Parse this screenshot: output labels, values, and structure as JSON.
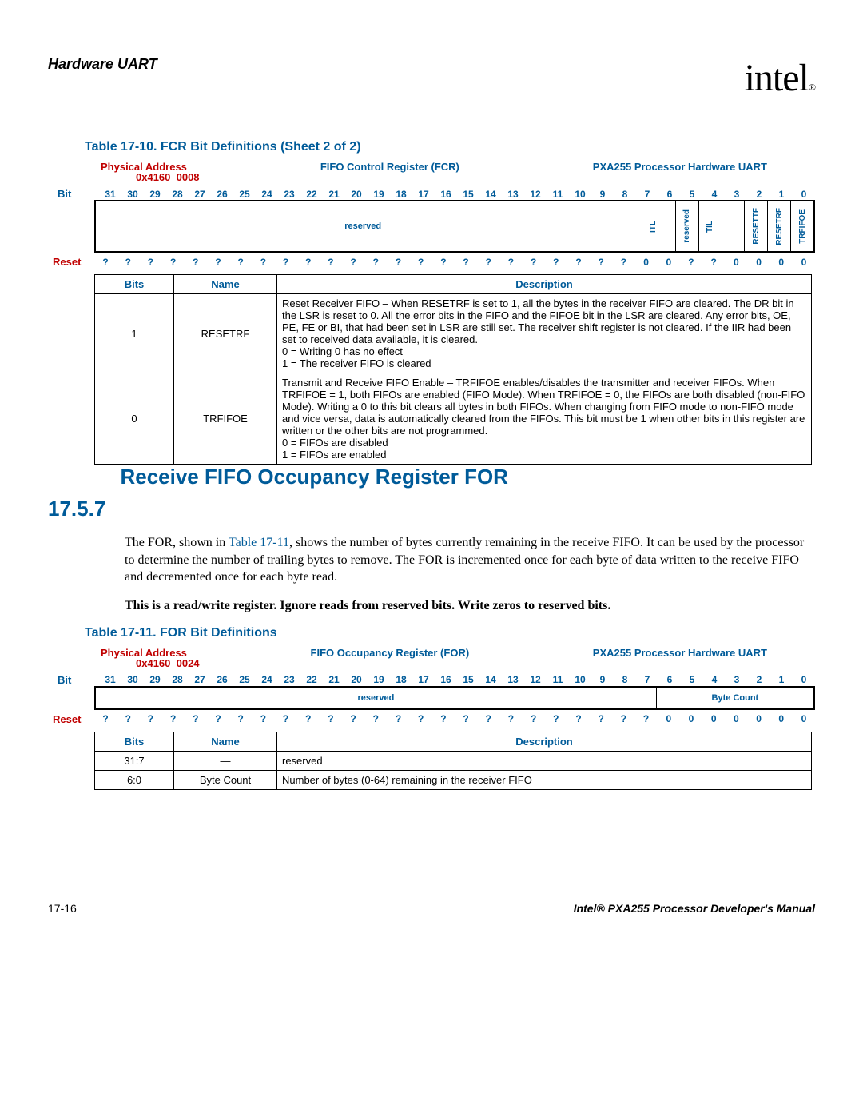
{
  "header": {
    "title": "Hardware UART",
    "logo": "intel",
    "logo_sub": "®"
  },
  "table1": {
    "title": "Table 17-10. FCR Bit Definitions (Sheet 2 of 2)",
    "pa_label": "Physical Address",
    "pa_addr": "0x4160_0008",
    "reg_name": "FIFO Control Register (FCR)",
    "proc": "PXA255 Processor Hardware UART",
    "bit_label": "Bit",
    "reset_label": "Reset",
    "bits": [
      "31",
      "30",
      "29",
      "28",
      "27",
      "26",
      "25",
      "24",
      "23",
      "22",
      "21",
      "20",
      "19",
      "18",
      "17",
      "16",
      "15",
      "14",
      "13",
      "12",
      "11",
      "10",
      "9",
      "8",
      "7",
      "6",
      "5",
      "4",
      "3",
      "2",
      "1",
      "0"
    ],
    "fields": [
      {
        "label": "reserved",
        "span": 24,
        "vert": false
      },
      {
        "label": "ITL",
        "span": 2,
        "vert": true
      },
      {
        "label": "reserved",
        "span": 1,
        "vert": true
      },
      {
        "label": "TIL",
        "span": 1,
        "vert": true
      },
      {
        "label": "",
        "span": 1,
        "vert": false
      },
      {
        "label": "RESETTF",
        "span": 1,
        "vert": true
      },
      {
        "label": "RESETRF",
        "span": 1,
        "vert": true
      },
      {
        "label": "TRFIFOE",
        "span": 1,
        "vert": true
      }
    ],
    "reset": [
      "?",
      "?",
      "?",
      "?",
      "?",
      "?",
      "?",
      "?",
      "?",
      "?",
      "?",
      "?",
      "?",
      "?",
      "?",
      "?",
      "?",
      "?",
      "?",
      "?",
      "?",
      "?",
      "?",
      "?",
      "0",
      "0",
      "?",
      "?",
      "0",
      "0",
      "0",
      "0"
    ],
    "hdr_bits": "Bits",
    "hdr_name": "Name",
    "hdr_desc": "Description",
    "rows": [
      {
        "bits": "1",
        "name": "RESETRF",
        "desc": "Reset Receiver FIFO – When RESETRF is set to 1, all the bytes in the receiver FIFO are cleared. The DR bit in the LSR is reset to 0. All the error bits in the FIFO and the FIFOE bit in the LSR are cleared. Any error bits, OE, PE, FE or BI, that had been set in LSR are still set. The receiver shift register is not cleared. If the IIR had been set to received data available, it is cleared.\n0 =  Writing 0 has no effect\n1 =  The receiver FIFO is cleared"
      },
      {
        "bits": "0",
        "name": "TRFIFOE",
        "desc": "Transmit and Receive FIFO Enable – TRFIFOE enables/disables the transmitter and receiver FIFOs. When TRFIFOE = 1, both FIFOs are enabled (FIFO Mode). When TRFIFOE = 0, the FIFOs are both disabled (non-FIFO Mode). Writing a 0 to this bit clears all bytes in both FIFOs. When changing from FIFO mode to non-FIFO mode and vice versa, data is automatically cleared from the FIFOs. This bit must be 1 when other bits in this register are written or the other bits are not programmed.\n0 =  FIFOs are disabled\n1 =  FIFOs are enabled"
      }
    ]
  },
  "section": {
    "num": "17.5.7",
    "title": "Receive FIFO Occupancy Register FOR",
    "p1a": "The FOR, shown in ",
    "p1_link": "Table 17-11",
    "p1b": ", shows the number of bytes currently remaining in the receive FIFO. It can be used by the processor to determine the number of trailing bytes to remove. The FOR is incremented once for each byte of data written to the receive FIFO and decremented once for each byte read.",
    "p2": "This is a read/write register. Ignore reads from reserved bits. Write zeros to reserved bits."
  },
  "table2": {
    "title": "Table 17-11. FOR Bit Definitions",
    "pa_label": "Physical Address",
    "pa_addr": "0x4160_0024",
    "reg_name": "FIFO Occupancy Register (FOR)",
    "proc": "PXA255 Processor Hardware UART",
    "bit_label": "Bit",
    "reset_label": "Reset",
    "bits": [
      "31",
      "30",
      "29",
      "28",
      "27",
      "26",
      "25",
      "24",
      "23",
      "22",
      "21",
      "20",
      "19",
      "18",
      "17",
      "16",
      "15",
      "14",
      "13",
      "12",
      "11",
      "10",
      "9",
      "8",
      "7",
      "6",
      "5",
      "4",
      "3",
      "2",
      "1",
      "0"
    ],
    "fields": [
      {
        "label": "reserved",
        "span": 25,
        "vert": false
      },
      {
        "label": "Byte Count",
        "span": 7,
        "vert": false
      }
    ],
    "reset": [
      "?",
      "?",
      "?",
      "?",
      "?",
      "?",
      "?",
      "?",
      "?",
      "?",
      "?",
      "?",
      "?",
      "?",
      "?",
      "?",
      "?",
      "?",
      "?",
      "?",
      "?",
      "?",
      "?",
      "?",
      "?",
      "0",
      "0",
      "0",
      "0",
      "0",
      "0",
      "0"
    ],
    "hdr_bits": "Bits",
    "hdr_name": "Name",
    "hdr_desc": "Description",
    "rows": [
      {
        "bits": "31:7",
        "name": "—",
        "desc": "reserved"
      },
      {
        "bits": "6:0",
        "name": "Byte Count",
        "desc": "Number of bytes (0-64) remaining in the receiver FIFO"
      }
    ]
  },
  "footer": {
    "left": "17-16",
    "right": "Intel® PXA255 Processor Developer's Manual"
  }
}
